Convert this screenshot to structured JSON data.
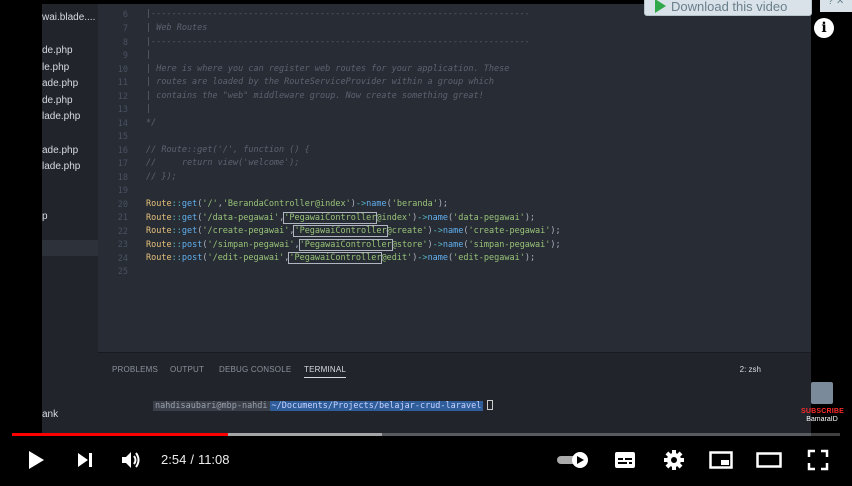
{
  "explorer": {
    "files": [
      "wai.blade....",
      "de.php",
      "le.php",
      "ade.php",
      "de.php",
      "lade.php",
      "ade.php",
      "lade.php",
      "p",
      "ank"
    ]
  },
  "editor": {
    "line_numbers": [
      "6",
      "7",
      "8",
      "9",
      "10",
      "11",
      "12",
      "13",
      "14",
      "15",
      "16",
      "17",
      "18",
      "19",
      "20",
      "21",
      "22",
      "23",
      "24",
      "25"
    ],
    "comment_rule": "|--------------------------------------------------------------------------",
    "header_title": "| Web Routes",
    "comment_pipe": "|",
    "comment_text_1": "| Here is where you can register web routes for your application. These",
    "comment_text_2": "| routes are loaded by the RouteServiceProvider within a group which",
    "comment_text_3": "| contains the \"web\" middleware group. Now create something great!",
    "comment_end": "*/",
    "commented_1": "// Route::get('/', function () {",
    "commented_2": "//     return view('welcome');",
    "commented_3": "// });",
    "routes": [
      {
        "method": "get",
        "uri": "'/'",
        "controller": "'BerandaController",
        "action": "@index'",
        "name": "'beranda'"
      },
      {
        "method": "get",
        "uri": "'/data-pegawai'",
        "controller": "'PegawaiController",
        "action": "@index'",
        "name": "'data-pegawai'"
      },
      {
        "method": "get",
        "uri": "'/create-pegawai'",
        "controller": "'PegawaiController",
        "action": "@create'",
        "name": "'create-pegawai'"
      },
      {
        "method": "post",
        "uri": "'/simpan-pegawai'",
        "controller": "'PegawaiController",
        "action": "@store'",
        "name": "'simpan-pegawai'"
      },
      {
        "method": "post",
        "uri": "'/edit-pegawai'",
        "controller": "'PegawaiController",
        "action": "@edit'",
        "name": "'edit-pegawai'"
      }
    ]
  },
  "panel": {
    "tabs": [
      "PROBLEMS",
      "OUTPUT",
      "DEBUG CONSOLE",
      "TERMINAL"
    ],
    "active_tab": "TERMINAL",
    "shell": "2: zsh",
    "terminal_user": "nahdisaubari@mbp-nahdi",
    "terminal_path": "~/Documents/Projects/belajar-crud-laravel"
  },
  "overlay": {
    "download_label": "Download this video",
    "info_glyph": "i",
    "channel_subscribe": "SUBSCRIBE",
    "channel_name": "BamaraID"
  },
  "player": {
    "current_time": "2:54",
    "separator": "/",
    "duration": "11:08",
    "progress_fraction": 0.261,
    "buffered_fraction": 0.447,
    "accent_color": "#ff0000"
  }
}
